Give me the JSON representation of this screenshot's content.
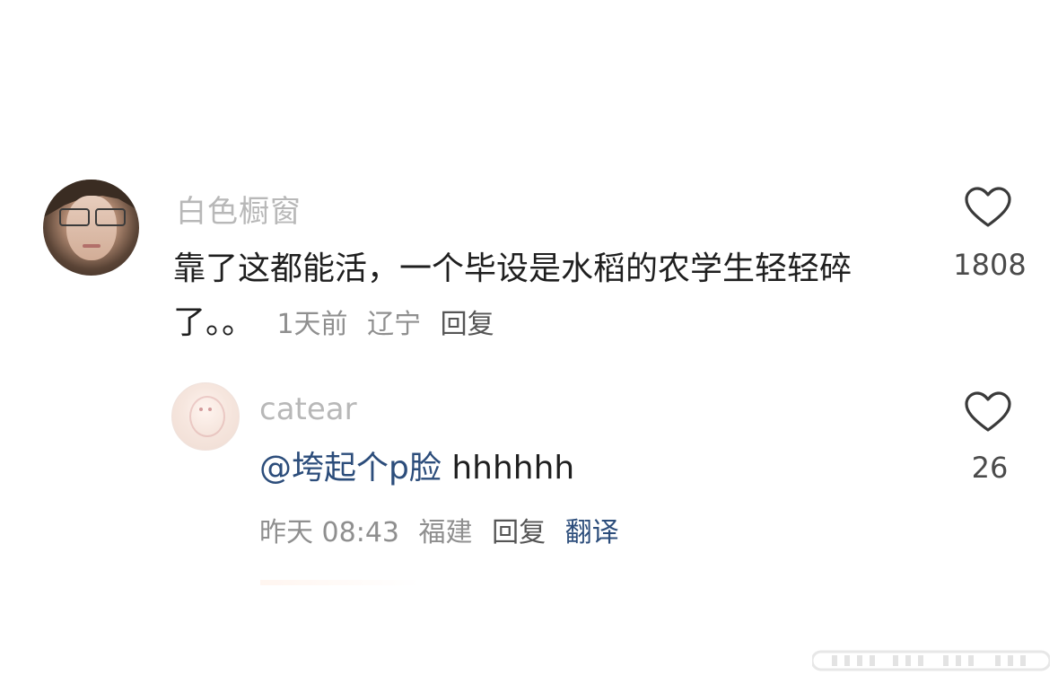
{
  "main_comment": {
    "username": "白色橱窗",
    "text": "靠了这都能活，一个毕设是水稻的农学生轻轻碎了。。",
    "time": "1天前",
    "location": "辽宁",
    "reply_label": "回复",
    "likes": "1808"
  },
  "reply_comment": {
    "username": "catear",
    "mention": "@垮起个p脸",
    "text": "hhhhhh",
    "time": "昨天 08:43",
    "location": "福建",
    "reply_label": "回复",
    "translate_label": "翻译",
    "likes": "26"
  },
  "colors": {
    "username": "#b8b8b8",
    "meta": "#8f8f8f",
    "mention": "#2c4d7b"
  },
  "icons": [
    "heart-outline-icon",
    "heart-outline-icon"
  ]
}
